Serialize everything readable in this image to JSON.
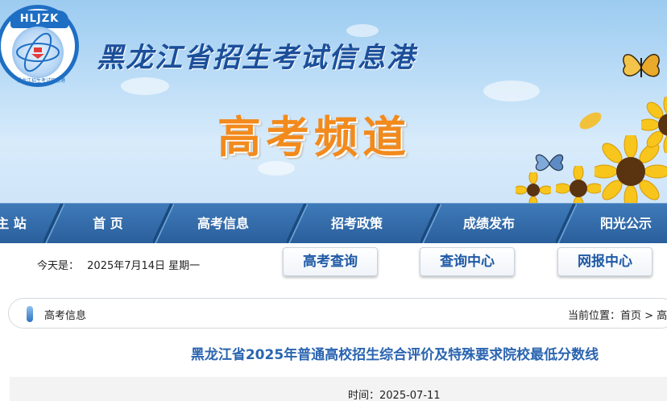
{
  "banner": {
    "logo_text": "HLJZK",
    "logo_caption": "黑龙江招生考试信息港",
    "site_title": "黑龙江省招生考试信息港",
    "channel_title": "高考频道"
  },
  "nav": {
    "items": [
      {
        "label": "主 站"
      },
      {
        "label": "首 页"
      },
      {
        "label": "高考信息"
      },
      {
        "label": "招考政策"
      },
      {
        "label": "成绩发布"
      },
      {
        "label": "阳光公示"
      }
    ]
  },
  "infobar": {
    "today_label": "今天是：",
    "date": "2025年7月14日 星期一",
    "buttons": [
      {
        "label": "高考查询"
      },
      {
        "label": "查询中心"
      },
      {
        "label": "网报中心"
      }
    ]
  },
  "breadcrumb": {
    "section": "高考信息",
    "location_label": "当前位置：",
    "home": "首页",
    "separator": " > ",
    "current": "高"
  },
  "article": {
    "title": "黑龙江省2025年普通高校招生综合评价及特殊要求院校最低分数线",
    "time_label": "时间：",
    "time": "2025-07-11"
  },
  "colors": {
    "nav_bg": "#2a5f9c",
    "accent_blue": "#2a64b0",
    "channel_orange": "#f28a1c"
  }
}
